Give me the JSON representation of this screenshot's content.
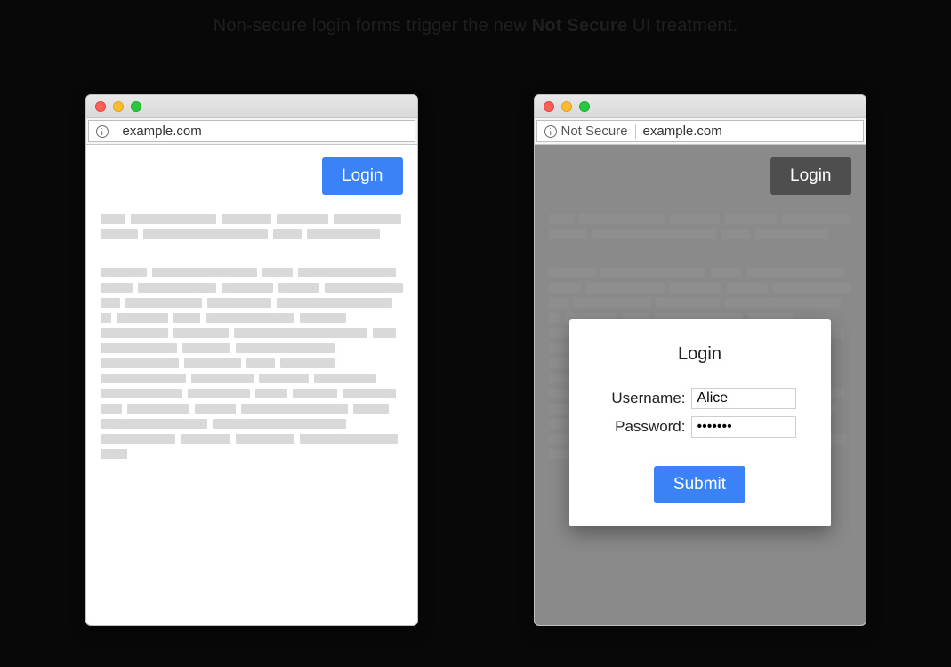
{
  "caption": {
    "pre": "Non-secure login forms trigger the new ",
    "bold": "Not Secure",
    "post": " UI treatment."
  },
  "left": {
    "address": "example.com",
    "login_button": "Login"
  },
  "right": {
    "not_secure_label": "Not Secure",
    "address": "example.com",
    "login_button": "Login",
    "modal": {
      "title": "Login",
      "username_label": "Username:",
      "username_value": "Alice",
      "password_label": "Password:",
      "password_value": "•••••••",
      "submit": "Submit"
    }
  }
}
